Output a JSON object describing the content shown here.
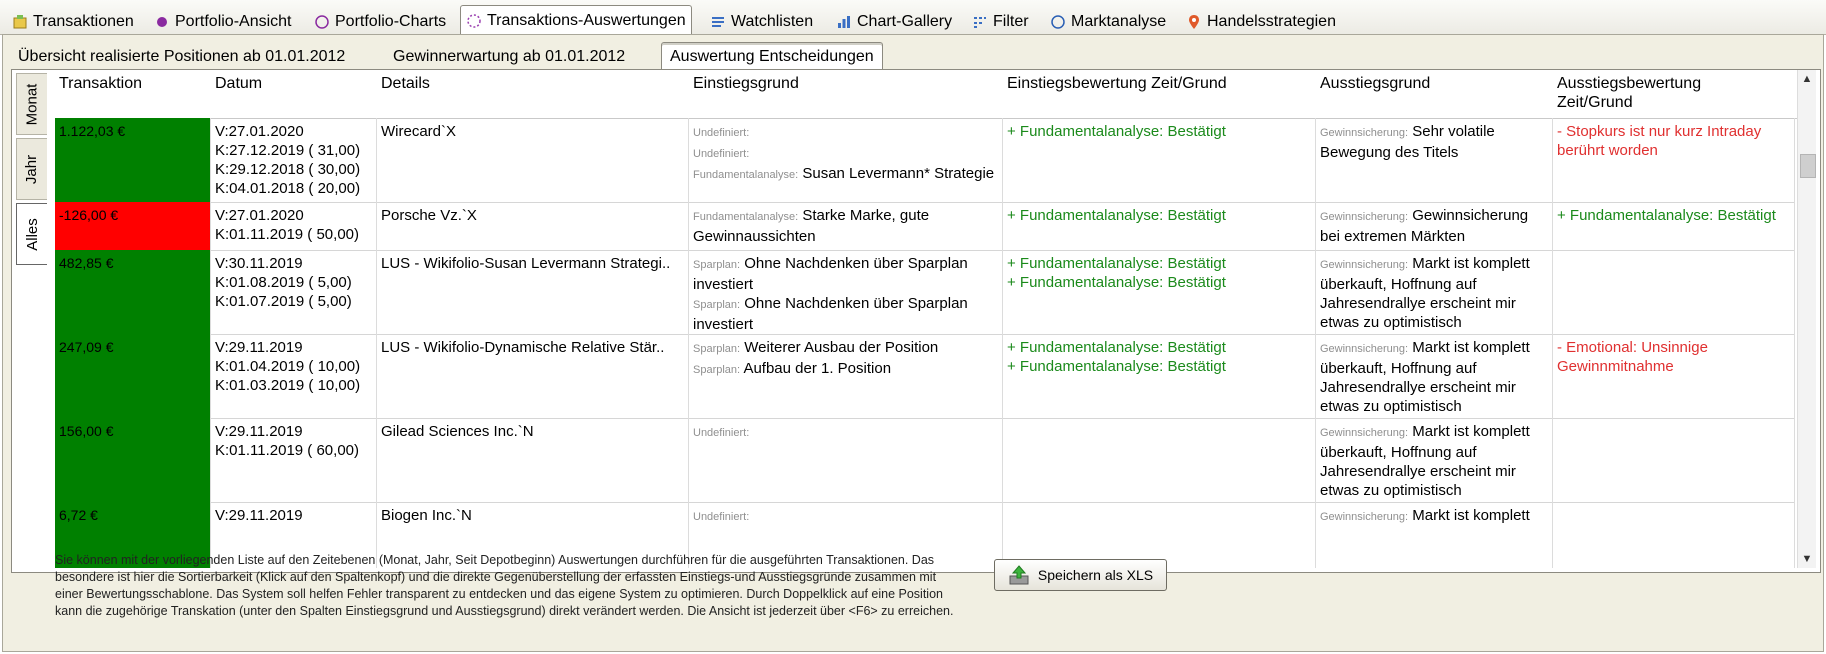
{
  "top_tabs": [
    {
      "label": "Transaktionen",
      "icon": "transactions-icon",
      "active": false
    },
    {
      "label": "Portfolio-Ansicht",
      "icon": "portfolio-dot-icon",
      "active": false
    },
    {
      "label": "Portfolio-Charts",
      "icon": "portfolio-ring-icon",
      "active": false
    },
    {
      "label": "Transaktions-Auswertungen",
      "icon": "loading-ring-icon",
      "active": true
    },
    {
      "label": "Watchlisten",
      "icon": "watchlist-icon",
      "active": false
    },
    {
      "label": "Chart-Gallery",
      "icon": "chart-icon",
      "active": false
    },
    {
      "label": "Filter",
      "icon": "filter-icon",
      "active": false
    },
    {
      "label": "Marktanalyse",
      "icon": "compass-icon",
      "active": false
    },
    {
      "label": "Handelsstrategien",
      "icon": "map-pin-icon",
      "active": false
    }
  ],
  "sub_tabs": [
    {
      "label": "Übersicht realisierte Positionen ab 01.01.2012",
      "active": false
    },
    {
      "label": "Gewinnerwartung ab 01.01.2012",
      "active": false
    },
    {
      "label": "Auswertung Entscheidungen",
      "active": true
    }
  ],
  "vertical_tabs": [
    {
      "label": "Monat",
      "active": false
    },
    {
      "label": "Jahr",
      "active": false
    },
    {
      "label": "Alles",
      "active": true
    }
  ],
  "columns": [
    "Transaktion",
    "Datum",
    "Details",
    "Einstiegsgrund",
    "Einstiegsbewertung Zeit/Grund",
    "Ausstiegsgrund",
    "Ausstiegsbewertung Zeit/Grund"
  ],
  "rows": [
    {
      "amount": "1.122,03 €",
      "color": "#008000",
      "dates": [
        "V:27.01.2020",
        "K:27.12.2019 ( 31,00)",
        "K:29.12.2018 ( 30,00)",
        "K:04.01.2018 ( 20,00)"
      ],
      "details": "Wirecard`X",
      "entry": [
        {
          "tag": "Undefiniert:",
          "text": ""
        },
        {
          "tag": "Undefiniert:",
          "text": ""
        },
        {
          "tag": "Fundamentalanalyse:",
          "text": "Susan Levermann* Strategie"
        }
      ],
      "entry_eval": [
        "+ Fundamentalanalyse: Bestätigt"
      ],
      "exit": [
        {
          "tag": "Gewinnsicherung:",
          "text": "Sehr volatile Bewegung des Titels"
        }
      ],
      "exit_eval": [
        "- Stopkurs ist nur kurz Intraday berührt worden"
      ],
      "exit_eval_color": "red"
    },
    {
      "amount": "-126,00 €",
      "color": "#ff0000",
      "dates": [
        "V:27.01.2020",
        "K:01.11.2019 ( 50,00)"
      ],
      "details": "Porsche Vz.`X",
      "entry": [
        {
          "tag": "Fundamentalanalyse:",
          "text": "Starke Marke, gute Gewinnaussichten"
        }
      ],
      "entry_eval": [
        "+ Fundamentalanalyse: Bestätigt"
      ],
      "exit": [
        {
          "tag": "Gewinnsicherung:",
          "text": "Gewinnsicherung bei extremen Märkten"
        }
      ],
      "exit_eval": [
        "+ Fundamentalanalyse: Bestätigt"
      ],
      "exit_eval_color": "green"
    },
    {
      "amount": "482,85 €",
      "color": "#008000",
      "dates": [
        "V:30.11.2019",
        "K:01.08.2019 (  5,00)",
        "K:01.07.2019 (  5,00)"
      ],
      "details": "LUS - Wikifolio-Susan Levermann Strategi..",
      "entry": [
        {
          "tag": "Sparplan:",
          "text": "Ohne Nachdenken über Sparplan investiert"
        },
        {
          "tag": "Sparplan:",
          "text": "Ohne Nachdenken über Sparplan investiert"
        }
      ],
      "entry_eval": [
        "+ Fundamentalanalyse: Bestätigt",
        "+ Fundamentalanalyse: Bestätigt"
      ],
      "exit": [
        {
          "tag": "Gewinnsicherung:",
          "text": "Markt ist komplett überkauft, Hoffnung auf Jahresendrallye erscheint mir etwas zu optimistisch"
        }
      ],
      "exit_eval": [],
      "exit_eval_color": "red"
    },
    {
      "amount": "247,09 €",
      "color": "#008000",
      "dates": [
        "V:29.11.2019",
        "K:01.04.2019 ( 10,00)",
        "K:01.03.2019 ( 10,00)"
      ],
      "details": "LUS - Wikifolio-Dynamische Relative Stär..",
      "entry": [
        {
          "tag": "Sparplan:",
          "text": "Weiterer Ausbau der Position"
        },
        {
          "tag": "Sparplan:",
          "text": "Aufbau der 1. Position"
        }
      ],
      "entry_eval": [
        "+ Fundamentalanalyse: Bestätigt",
        "+ Fundamentalanalyse: Bestätigt"
      ],
      "exit": [
        {
          "tag": "Gewinnsicherung:",
          "text": "Markt ist komplett überkauft, Hoffnung auf Jahresendrallye erscheint mir etwas zu optimistisch"
        }
      ],
      "exit_eval": [
        "- Emotional: Unsinnige Gewinnmitnahme"
      ],
      "exit_eval_color": "red"
    },
    {
      "amount": "156,00 €",
      "color": "#008000",
      "dates": [
        "V:29.11.2019",
        "K:01.11.2019 ( 60,00)"
      ],
      "details": "Gilead Sciences Inc.`N",
      "entry": [
        {
          "tag": "Undefiniert:",
          "text": ""
        }
      ],
      "entry_eval": [],
      "exit": [
        {
          "tag": "Gewinnsicherung:",
          "text": "Markt ist komplett überkauft, Hoffnung auf Jahresendrallye erscheint mir etwas zu optimistisch"
        }
      ],
      "exit_eval": [],
      "exit_eval_color": "red"
    },
    {
      "amount": "6,72 €",
      "color": "#008000",
      "dates": [
        "V:29.11.2019"
      ],
      "details": "Biogen Inc.`N",
      "entry": [
        {
          "tag": "Undefiniert:",
          "text": ""
        }
      ],
      "entry_eval": [],
      "exit": [
        {
          "tag": "Gewinnsicherung:",
          "text": "Markt ist komplett"
        }
      ],
      "exit_eval": [],
      "exit_eval_color": "red"
    }
  ],
  "footer": {
    "text": "Sie können mit der vorliegenden Liste auf den Zeitebenen (Monat, Jahr, Seit Depotbeginn) Auswertungen durchführen für die ausgeführten Transaktionen. Das besondere ist hier die Sortierbarkeit (Klick auf den Spaltenkopf) und die direkte Gegenüberstellung der erfassten Einstiegs-und Ausstiegsgründe zusammen mit einer Bewertungsschablone. Das System soll helfen Fehler transparent zu entdecken und das eigene System zu optimieren. Durch Doppelklick auf eine Position kann die zugehörige Transkation (unter den Spalten Einstiegsgrund und Ausstiegsgrund) direkt verändert werden. Die Ansicht ist jederzeit über <F6> zu erreichen.",
    "save_label": "Speichern als XLS"
  },
  "colors": {
    "positive": "#008000",
    "negative": "#ff0000",
    "eval_green": "#1b8a1b",
    "eval_red": "#e03030"
  }
}
